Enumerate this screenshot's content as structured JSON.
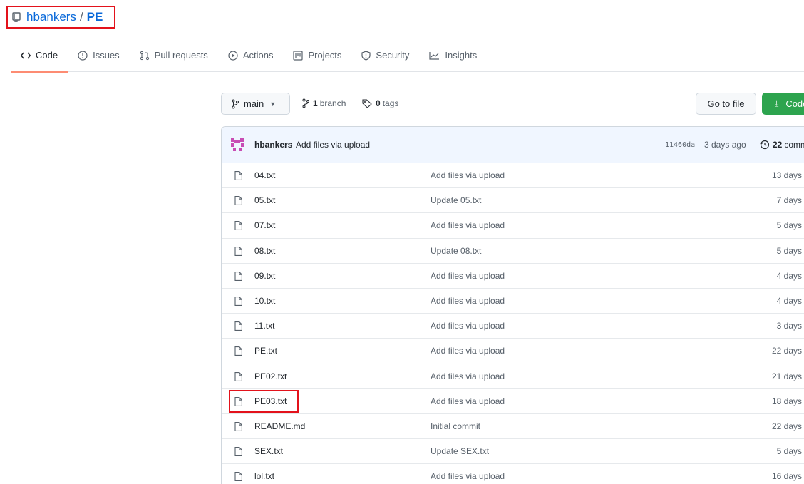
{
  "repo": {
    "owner": "hbankers",
    "separator": "/",
    "name": "PE"
  },
  "tabs": [
    {
      "label": "Code",
      "icon": "code-icon",
      "active": true
    },
    {
      "label": "Issues",
      "icon": "issue-icon"
    },
    {
      "label": "Pull requests",
      "icon": "pull-request-icon"
    },
    {
      "label": "Actions",
      "icon": "play-icon"
    },
    {
      "label": "Projects",
      "icon": "project-icon"
    },
    {
      "label": "Security",
      "icon": "shield-icon"
    },
    {
      "label": "Insights",
      "icon": "graph-icon"
    }
  ],
  "toolbar": {
    "branch_name": "main",
    "branch_count": "1",
    "branch_label": "branch",
    "tag_count": "0",
    "tag_label": "tags",
    "goto_label": "Go to file",
    "code_label": "Code"
  },
  "latest_commit": {
    "author": "hbankers",
    "message": "Add files via upload",
    "sha": "11460da",
    "time": "3 days ago",
    "count": "22",
    "count_label": "commits"
  },
  "files": [
    {
      "name": "04.txt",
      "message": "Add files via upload",
      "age": "13 days"
    },
    {
      "name": "05.txt",
      "message": "Update 05.txt",
      "age": "7 days"
    },
    {
      "name": "07.txt",
      "message": "Add files via upload",
      "age": "5 days"
    },
    {
      "name": "08.txt",
      "message": "Update 08.txt",
      "age": "5 days"
    },
    {
      "name": "09.txt",
      "message": "Add files via upload",
      "age": "4 days"
    },
    {
      "name": "10.txt",
      "message": "Add files via upload",
      "age": "4 days"
    },
    {
      "name": "11.txt",
      "message": "Add files via upload",
      "age": "3 days"
    },
    {
      "name": "PE.txt",
      "message": "Add files via upload",
      "age": "22 days"
    },
    {
      "name": "PE02.txt",
      "message": "Add files via upload",
      "age": "21 days"
    },
    {
      "name": "PE03.txt",
      "message": "Add files via upload",
      "age": "18 days"
    },
    {
      "name": "README.md",
      "message": "Initial commit",
      "age": "22 days"
    },
    {
      "name": "SEX.txt",
      "message": "Update SEX.txt",
      "age": "5 days"
    },
    {
      "name": "lol.txt",
      "message": "Add files via upload",
      "age": "16 days"
    }
  ],
  "colors": {
    "link": "#0969da",
    "highlight": "#e3121b",
    "code_button": "#2da44e",
    "tab_underline": "#fd8c73"
  }
}
